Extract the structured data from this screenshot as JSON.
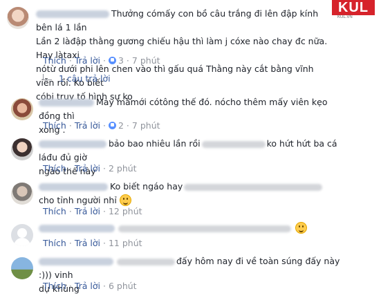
{
  "brand": {
    "logo_text": "KUL",
    "logo_sub": "KUL.VN"
  },
  "actions": {
    "like": "Thích",
    "reply": "Trả lời",
    "separator": "·"
  },
  "comments": [
    {
      "line1": "Thưởng cómấy con bồ câu trắng đi lên đập kính bên lá 1 lần",
      "line2": "Lần 2 làđập thằng gương chiếu hậu thì làm j cóxe nào chay đc nữa.  Hay làtaxi",
      "line3": "nótừ dưới phi lên chen vào thì gấu quá Thằng này cắt bằng vĩnh viễn rồi. Ko biết",
      "line4": "cóbị truy tố hình sự ko",
      "reactions": "3",
      "time": "7 phút",
      "replies_label": "1 câu trả lời"
    },
    {
      "line1": "May màmới cótông thế đó. nócho thêm mấy viên kẹo đồng thì",
      "line2": "xong .",
      "reactions": "2",
      "time": "7 phút"
    },
    {
      "line1a": "bảo bao nhiêu lần rồi",
      "line1b": "ko hứt hứt ba cá láđu đủ giờ",
      "line2": "ngáo thế này",
      "time": "2 phút"
    },
    {
      "line1": "Ko biết ngáo hay",
      "line2": "cho tỉnh người nhỉ",
      "time": "12 phút"
    },
    {
      "time": "11 phút"
    },
    {
      "line1": "đấy hôm nay đi về toàn súng đấy này :))) vinh",
      "line2": "dự khủng",
      "time": "6 phút"
    }
  ]
}
